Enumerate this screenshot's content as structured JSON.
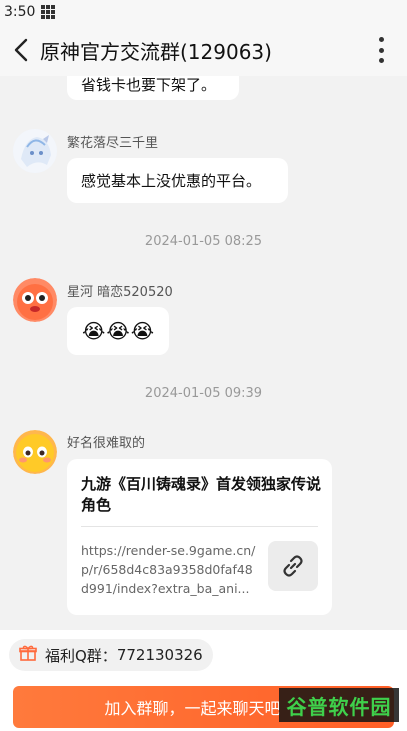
{
  "status_bar": {
    "time": "3:50"
  },
  "header": {
    "title": "原神官方交流群(129063)"
  },
  "messages": [
    {
      "text": "省钱卡也要下架了。"
    },
    {
      "nick": "繁花落尽三千里",
      "text": "感觉基本上没优惠的平台。"
    },
    {
      "timestamp": "2024-01-05  08:25"
    },
    {
      "nick": "星河 暗恋520520",
      "emojis": [
        "😭",
        "😭",
        "😭"
      ]
    },
    {
      "timestamp": "2024-01-05  09:39"
    },
    {
      "nick": "好名很难取的",
      "card": {
        "title": "九游《百川铸魂录》首发领独家传说角色",
        "url": "https://render-se.9game.cn/p/r/658d4c83a9358d0faf48d991/index?extra_ba_ani..."
      }
    }
  ],
  "footer": {
    "qq_group_label": "福利Q群：",
    "qq_group_number": "772130326",
    "join_button": "加入群聊，一起来聊天吧",
    "watermark": "谷普软件园"
  },
  "colors": {
    "accent": "#ff6a2f",
    "background": "#f2f2f2"
  }
}
